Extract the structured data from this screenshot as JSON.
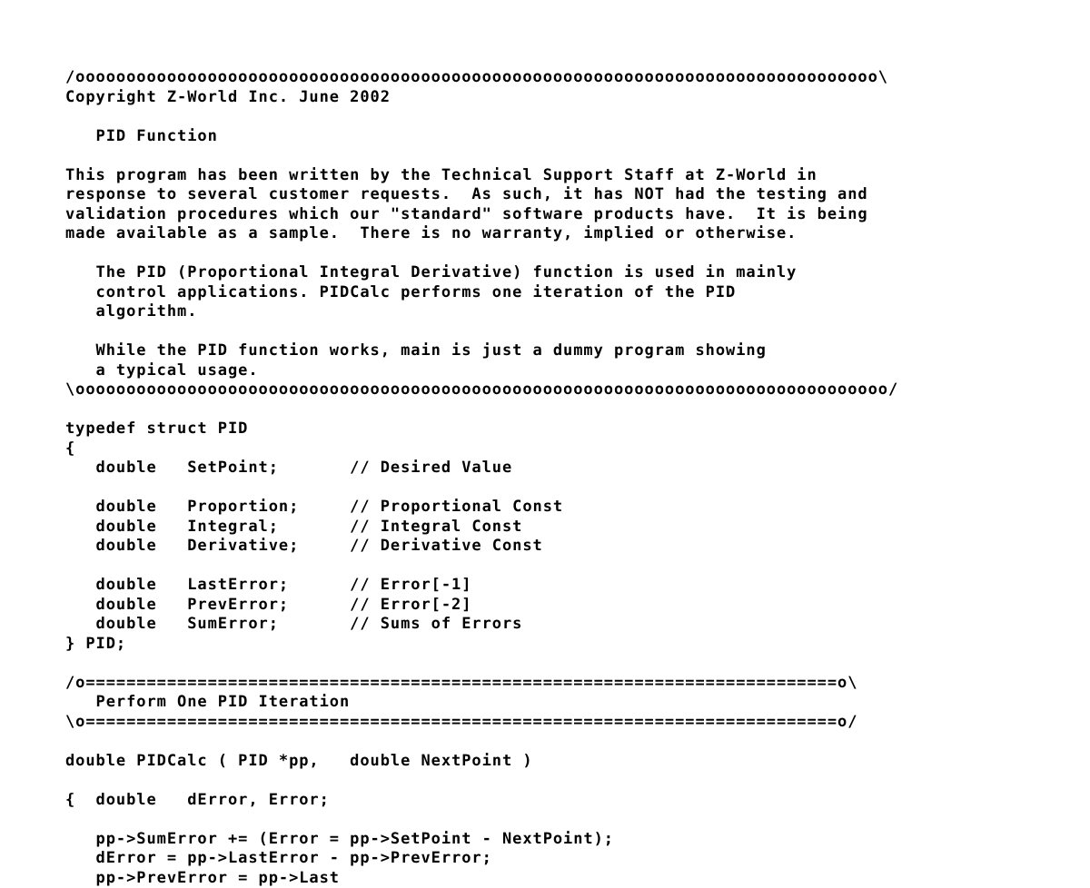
{
  "document": {
    "kind": "source-code-listing",
    "language": "c",
    "title": "PID Function",
    "background_color": "#ffffff",
    "text_color": "#000000"
  },
  "code": {
    "lines": [
      "/ooooooooooooooooooooooooooooooooooooooooooooooooooooooooooooooooooooooooooooooo\\",
      "Copyright Z-World Inc. June 2002",
      "",
      "   PID Function",
      "",
      "This program has been written by the Technical Support Staff at Z-World in",
      "response to several customer requests.  As such, it has NOT had the testing and",
      "validation procedures which our \"standard\" software products have.  It is being",
      "made available as a sample.  There is no warranty, implied or otherwise.",
      "",
      "   The PID (Proportional Integral Derivative) function is used in mainly",
      "   control applications. PIDCalc performs one iteration of the PID",
      "   algorithm.",
      "",
      "   While the PID function works, main is just a dummy program showing",
      "   a typical usage.",
      "\\oooooooooooooooooooooooooooooooooooooooooooooooooooooooooooooooooooooooooooooooo/",
      "",
      "typedef struct PID",
      "{",
      "   double   SetPoint;       // Desired Value",
      "",
      "   double   Proportion;     // Proportional Const",
      "   double   Integral;       // Integral Const",
      "   double   Derivative;     // Derivative Const",
      "",
      "   double   LastError;      // Error[-1]",
      "   double   PrevError;      // Error[-2]",
      "   double   SumError;       // Sums of Errors",
      "} PID;",
      "",
      "/o==========================================================================o\\",
      "   Perform One PID Iteration",
      "\\o==========================================================================o/",
      "",
      "double PIDCalc ( PID *pp,   double NextPoint )",
      "",
      "{  double   dError, Error;",
      "",
      "   pp->SumError += (Error = pp->SetPoint - NextPoint);",
      "   dError = pp->LastError - pp->PrevError;",
      "   pp->PrevError = pp->Last"
    ],
    "comment_blocks": [
      {
        "name": "file-header-comment",
        "open_delimiter": "/o",
        "close_delimiter": "o\\",
        "fill_char": "o",
        "heading": "Copyright Z-World Inc. June 2002",
        "subheading": "PID Function"
      },
      {
        "name": "pid-iteration-comment",
        "open_delimiter": "/o",
        "close_delimiter": "o\\",
        "fill_char": "=",
        "heading": "Perform One PID Iteration",
        "subheading": ""
      }
    ],
    "struct": {
      "name": "PID",
      "keyword": "typedef struct",
      "open_brace": "{",
      "close": "} PID;",
      "members": [
        {
          "type": "double",
          "name": "SetPoint;",
          "comment": "// Desired Value"
        },
        {
          "type": "double",
          "name": "Proportion;",
          "comment": "// Proportional Const"
        },
        {
          "type": "double",
          "name": "Integral;",
          "comment": "// Integral Const"
        },
        {
          "type": "double",
          "name": "Derivative;",
          "comment": "// Derivative Const"
        },
        {
          "type": "double",
          "name": "LastError;",
          "comment": "// Error[-1]"
        },
        {
          "type": "double",
          "name": "PrevError;",
          "comment": "// Error[-2]"
        },
        {
          "type": "double",
          "name": "SumError;",
          "comment": "// Sums of Errors"
        }
      ]
    },
    "function": {
      "signature": "double PIDCalc ( PID *pp,   double NextPoint )",
      "open_brace_line": "{  double   dError, Error;",
      "body": [
        "pp->SumError += (Error = pp->SetPoint - NextPoint);",
        "dError = pp->LastError - pp->PrevError;",
        "pp->PrevError = pp->Last"
      ]
    },
    "paragraphs": [
      "This program has been written by the Technical Support Staff at Z-World in response to several customer requests.  As such, it has NOT had the testing and validation procedures which our \"standard\" software products have.  It is being made available as a sample.  There is no warranty, implied or otherwise.",
      "The PID (Proportional Integral Derivative) function is used in mainly control applications. PIDCalc performs one iteration of the PID algorithm.",
      "While the PID function works, main is just a dummy program showing a typical usage."
    ]
  }
}
